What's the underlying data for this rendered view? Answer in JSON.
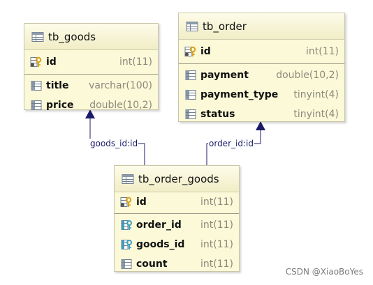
{
  "tables": {
    "goods": {
      "name": "tb_goods",
      "columns": [
        {
          "name": "id",
          "type": "int(11)",
          "kind": "primary-key"
        },
        {
          "name": "title",
          "type": "varchar(100)",
          "kind": "column"
        },
        {
          "name": "price",
          "type": "double(10,2)",
          "kind": "column"
        }
      ]
    },
    "order": {
      "name": "tb_order",
      "columns": [
        {
          "name": "id",
          "type": "int(11)",
          "kind": "primary-key"
        },
        {
          "name": "payment",
          "type": "double(10,2)",
          "kind": "column"
        },
        {
          "name": "payment_type",
          "type": "tinyint(4)",
          "kind": "column"
        },
        {
          "name": "status",
          "type": "tinyint(4)",
          "kind": "column"
        }
      ]
    },
    "order_goods": {
      "name": "tb_order_goods",
      "columns": [
        {
          "name": "id",
          "type": "int(11)",
          "kind": "primary-key"
        },
        {
          "name": "order_id",
          "type": "int(11)",
          "kind": "foreign-key"
        },
        {
          "name": "goods_id",
          "type": "int(11)",
          "kind": "foreign-key"
        },
        {
          "name": "count",
          "type": "int(11)",
          "kind": "column"
        }
      ]
    }
  },
  "relations": [
    {
      "label": "goods_id:id",
      "from": "tb_order_goods",
      "to": "tb_goods"
    },
    {
      "label": "order_id:id",
      "from": "tb_order_goods",
      "to": "tb_order"
    }
  ],
  "watermark": "CSDN @XiaoBoYes",
  "colors": {
    "table_fill": "#fcf9d8",
    "connector": "#1b1b6a",
    "key_icon": "#d9a21c",
    "fk_icon": "#3aa0c8"
  }
}
